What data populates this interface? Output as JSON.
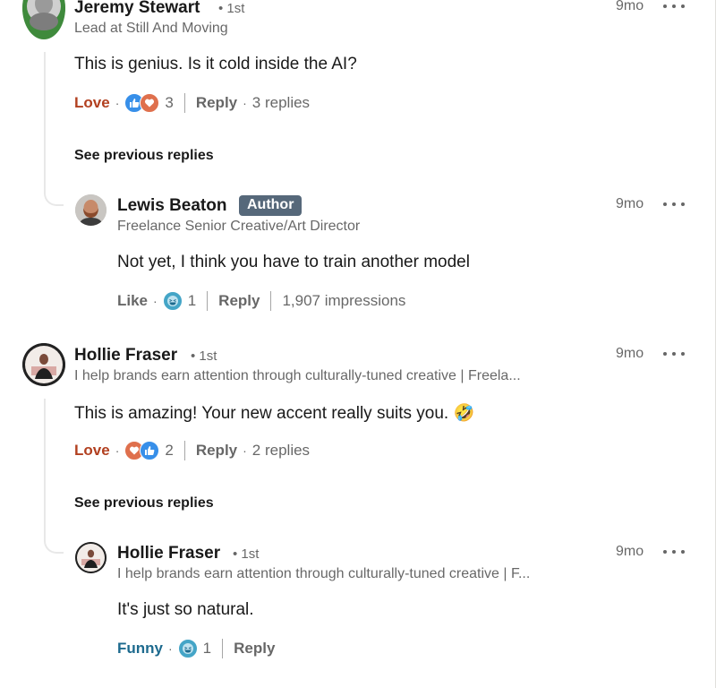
{
  "colors": {
    "love": "#b24020",
    "funny": "#1d6a8e",
    "like_blue": "#378fe9",
    "heart_red": "#df704d",
    "author_badge": "#56687a"
  },
  "comments": [
    {
      "name": "Jeremy Stewart",
      "degree": "• 1st",
      "headline": "Lead at Still And Moving",
      "time": "9mo",
      "text": "This is genius. Is it cold inside the AI?",
      "reaction_label": "Love",
      "reaction_icons": [
        "like-icon",
        "heart-icon"
      ],
      "reaction_count": "3",
      "reply_label": "Reply",
      "replies": "3 replies",
      "see_previous": "See previous replies",
      "reply": {
        "name": "Lewis Beaton",
        "badge": "Author",
        "headline": "Freelance Senior Creative/Art Director",
        "time": "9mo",
        "text": "Not yet, I think you have to train another model",
        "reaction_label": "Like",
        "reaction_icons": [
          "laugh-icon"
        ],
        "reaction_count": "1",
        "reply_label": "Reply",
        "impressions": "1,907 impressions"
      }
    },
    {
      "name": "Hollie Fraser",
      "degree": "• 1st",
      "headline": "I help brands earn attention through culturally-tuned creative | Freela...",
      "time": "9mo",
      "text": "This is amazing! Your new accent really suits you. 🤣",
      "reaction_label": "Love",
      "reaction_icons": [
        "heart-icon",
        "like-icon"
      ],
      "reaction_count": "2",
      "reply_label": "Reply",
      "replies": "2 replies",
      "see_previous": "See previous replies",
      "reply": {
        "name": "Hollie Fraser",
        "degree": "• 1st",
        "headline": "I help brands earn attention through culturally-tuned creative | F...",
        "time": "9mo",
        "text": "It's just so natural.",
        "reaction_label": "Funny",
        "reaction_icons": [
          "laugh-icon"
        ],
        "reaction_count": "1",
        "reply_label": "Reply"
      }
    }
  ]
}
